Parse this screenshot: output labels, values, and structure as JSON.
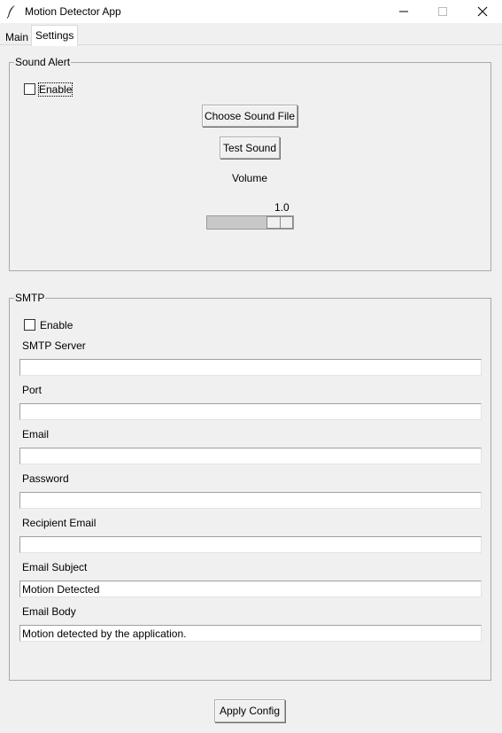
{
  "window": {
    "title": "Motion Detector App",
    "controls": {
      "minimize": "minimize-icon",
      "maximize": "maximize-icon",
      "close": "close-icon"
    }
  },
  "tabs": [
    {
      "label": "Main",
      "active": false
    },
    {
      "label": "Settings",
      "active": true
    }
  ],
  "sound_alert": {
    "title": "Sound Alert",
    "enable_label": "Enable",
    "enabled": false,
    "choose_file_label": "Choose Sound File",
    "test_sound_label": "Test Sound",
    "volume_label": "Volume",
    "volume_value": "1.0",
    "volume_fraction": 1.0
  },
  "smtp": {
    "title": "SMTP",
    "enable_label": "Enable",
    "enabled": false,
    "fields": [
      {
        "label": "SMTP Server",
        "value": ""
      },
      {
        "label": "Port",
        "value": ""
      },
      {
        "label": "Email",
        "value": ""
      },
      {
        "label": "Password",
        "value": ""
      },
      {
        "label": "Recipient Email",
        "value": ""
      },
      {
        "label": "Email Subject",
        "value": "Motion Detected"
      },
      {
        "label": "Email Body",
        "value": "Motion detected by the application."
      }
    ]
  },
  "apply_label": "Apply Config",
  "colors": {
    "window_bg": "#f0f0f0",
    "titlebar_bg": "#ffffff",
    "border": "#a9a9a9"
  }
}
